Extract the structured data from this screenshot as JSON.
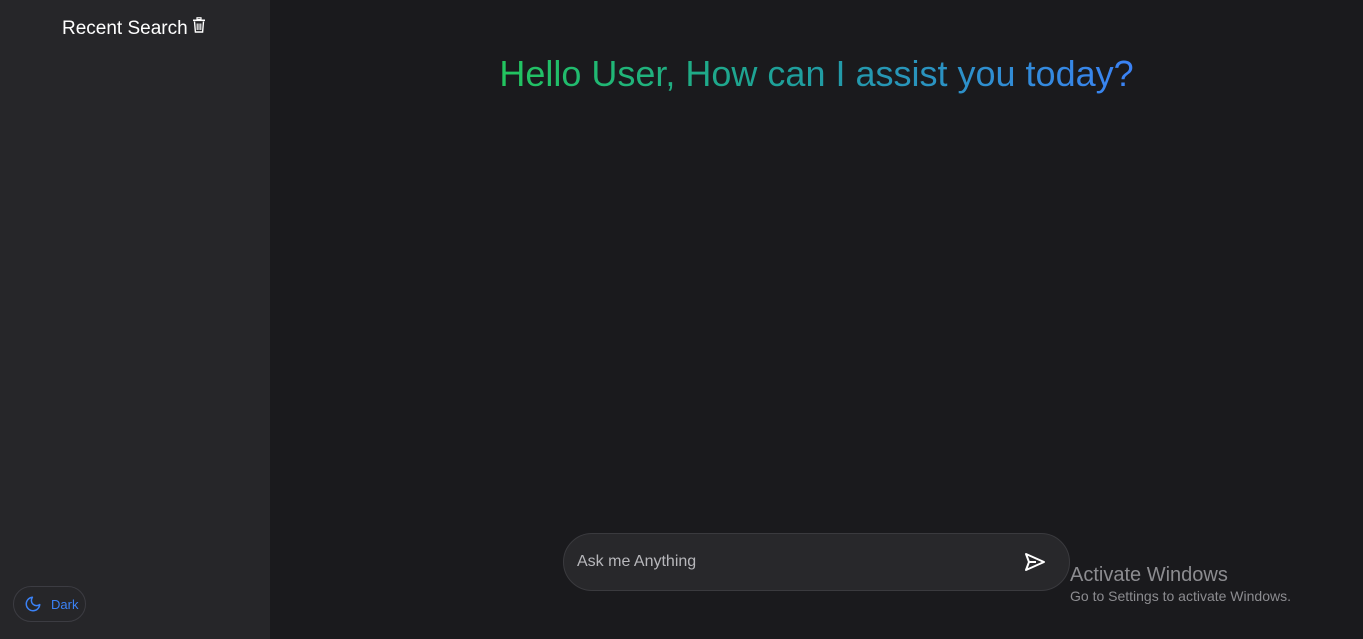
{
  "sidebar": {
    "title": "Recent Search",
    "trash_icon": "trash-icon",
    "theme_toggle_label": "Dark",
    "theme_icon": "moon-icon"
  },
  "main": {
    "greeting": "Hello User, How can I assist you today?",
    "greeting_gradient": [
      "#22c55e",
      "#1e9f9a",
      "#3b82f6"
    ]
  },
  "chat_input": {
    "placeholder": "Ask me Anything",
    "value": "",
    "send_icon": "send-icon"
  },
  "watermark": {
    "title": "Activate Windows",
    "subtitle": "Go to Settings to activate Windows."
  },
  "colors": {
    "background": "#1a1a1d",
    "sidebar": "#262629",
    "accent": "#3b82f6"
  }
}
